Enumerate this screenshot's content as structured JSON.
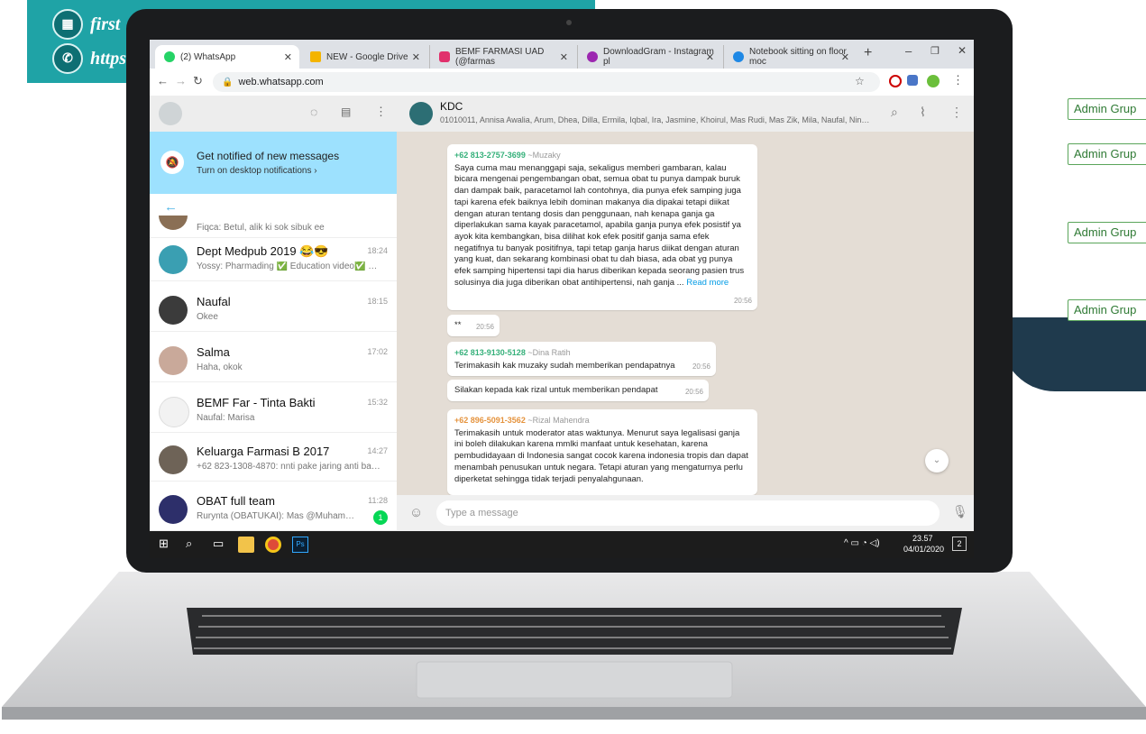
{
  "background": {
    "banner_lines": [
      "first",
      "https"
    ],
    "admin_labels": [
      "Admin Grup",
      "Admin Grup",
      "Admin Grup",
      "Admin Grup"
    ]
  },
  "browser": {
    "tabs": [
      {
        "label": "(2) WhatsApp",
        "color": "#25d366"
      },
      {
        "label": "NEW - Google Drive",
        "color": "#f4b400"
      },
      {
        "label": "BEMF FARMASI UAD (@farmas",
        "color": "#e1306c"
      },
      {
        "label": "DownloadGram - Instagram pl",
        "color": "#9c27b0"
      },
      {
        "label": "Notebook sitting on floor moc",
        "color": "#1e88e5"
      }
    ],
    "url": "web.whatsapp.com"
  },
  "sidebar": {
    "notification": {
      "title": "Get notified of new messages",
      "subtitle": "Turn on desktop notifications ›"
    },
    "partial_preview": "Fiqca: Betul, alik ki sok sibuk ee",
    "chats": [
      {
        "name": "Dept Medpub 2019 😂😎",
        "preview": "Yossy: Pharmading ✅ Education video✅ E B...",
        "time": "18:24"
      },
      {
        "name": "Naufal",
        "preview": "Okee",
        "time": "18:15"
      },
      {
        "name": "Salma",
        "preview": "Haha, okok",
        "time": "17:02"
      },
      {
        "name": "BEMF Far - Tinta Bakti",
        "preview": "Naufal: Marisa",
        "time": "15:32"
      },
      {
        "name": "Keluarga Farmasi B 2017",
        "preview": "+62 823-1308-4870: nnti pake jaring anti bac...",
        "time": "14:27"
      },
      {
        "name": "OBAT full team",
        "preview": "Rurynta (OBATUKAI): Mas @Muhammad F...",
        "time": "11:28",
        "unread": "1"
      }
    ]
  },
  "conversation": {
    "group_name": "KDC",
    "members": "01010011, Annisa Awalia, Arum, Dhea, Dilla, Ermila, Iqbal, Ira, Jasmine, Khoirul, Mas Rudi, Mas Zik, Mila, Naufal, Ningrum, ...",
    "messages": [
      {
        "sender": "+62 813-2757-3699",
        "alias": "~Muzaky",
        "text": "Saya cuma mau menanggapi saja, sekaligus memberi gambaran, kalau bicara mengenai pengembangan obat, semua obat tu punya dampak buruk dan dampak baik, paracetamol lah contohnya, dia punya efek samping juga tapi karena efek baiknya lebih dominan makanya dia dipakai tetapi diikat dengan aturan tentang dosis dan penggunaan, nah kenapa ganja ga diperlakukan sama kayak paracetamol, apabila ganja punya efek posistif ya ayok kita kembangkan, bisa dilihat kok efek positif ganja sama efek negatifnya tu banyak positifnya, tapi tetap ganja harus diikat dengan aturan yang kuat, dan sekarang kombinasi obat tu dah biasa, ada obat yg punya efek samping hipertensi tapi dia harus diberikan kepada seorang pasien trus solusinya dia juga diberikan obat antihipertensi, nah ganja ...",
        "read_more": "Read more",
        "time": "20:56"
      },
      {
        "text": "**",
        "time": "20:56"
      },
      {
        "sender": "+62 813-9130-5128",
        "alias": "~Dina Ratih",
        "text": "Terimakasih kak muzaky sudah memberikan pendapatnya",
        "time": "20:56"
      },
      {
        "text": "Silakan kepada kak rizal untuk memberikan pendapat",
        "time": "20:56"
      },
      {
        "sender": "+62 896-5091-3562",
        "alias": "~Rizal Mahendra",
        "text": "Terimakasih untuk moderator atas waktunya. Menurut saya legalisasi ganja ini boleh dilakukan karena mmlki manfaat untuk kesehatan, karena pembudidayaan di Indonesia sangat cocok karena indonesia tropis dan dapat menambah penusukan untuk negara. Tetapi aturan yang mengaturnya perlu diperketat sehingga tidak terjadi penyalahgunaan."
      }
    ],
    "composer_placeholder": "Type a message"
  },
  "taskbar": {
    "time": "23.57",
    "date": "04/01/2020",
    "notification_count": "2"
  }
}
